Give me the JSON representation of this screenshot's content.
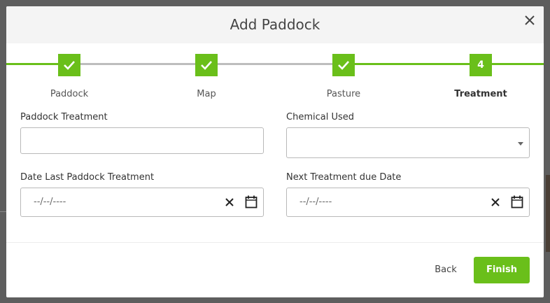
{
  "modal": {
    "title": "Add Paddock",
    "close_icon": "close-icon"
  },
  "stepper": {
    "steps": [
      {
        "label": "Paddock",
        "state": "complete",
        "icon": "check-icon"
      },
      {
        "label": "Map",
        "state": "complete",
        "icon": "check-icon"
      },
      {
        "label": "Pasture",
        "state": "complete",
        "icon": "check-icon"
      },
      {
        "label": "Treatment",
        "state": "active",
        "number": "4"
      }
    ]
  },
  "form": {
    "paddock_treatment": {
      "label": "Paddock Treatment",
      "value": ""
    },
    "chemical_used": {
      "label": "Chemical Used",
      "value": ""
    },
    "date_last_treatment": {
      "label": "Date Last Paddock Treatment",
      "value": "--/--/----"
    },
    "next_treatment_due": {
      "label": "Next Treatment due Date",
      "value": "--/--/----"
    }
  },
  "footer": {
    "back_label": "Back",
    "finish_label": "Finish"
  },
  "colors": {
    "accent": "#6abf1a",
    "overlay": "#5e5e5e",
    "header_bg": "#f4f4f4"
  }
}
